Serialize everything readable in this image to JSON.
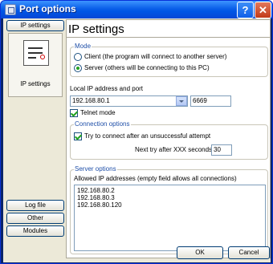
{
  "window": {
    "title": "Port options"
  },
  "sidebar": {
    "top_tab_label": "IP settings",
    "active_label": "IP settings",
    "items": [
      {
        "label": "Log file"
      },
      {
        "label": "Other"
      },
      {
        "label": "Modules"
      }
    ]
  },
  "main": {
    "heading": "IP settings",
    "mode": {
      "label": "Mode",
      "client_option": "Client (the program will connect to another server)",
      "server_option": "Server (others will be connecting to this PC)",
      "selected": "server"
    },
    "local": {
      "label": "Local IP address and port",
      "ip_value": "192.168.80.1",
      "port_value": "6669",
      "telnet_label": "Telnet mode",
      "telnet_checked": true
    },
    "connection": {
      "label": "Connection options",
      "retry_label": "Try to connect after an unsuccessful attempt",
      "retry_checked": true,
      "next_try_label": "Next try after XXX seconds",
      "next_try_value": "30"
    },
    "server": {
      "label": "Server options",
      "allowed_label": "Allowed IP addresses (empty field allows all connections)",
      "allowed_ips": [
        "192.168.80.2",
        "192.168.80.3",
        "192.168.80.120"
      ]
    }
  },
  "buttons": {
    "ok": "OK",
    "cancel": "Cancel"
  }
}
